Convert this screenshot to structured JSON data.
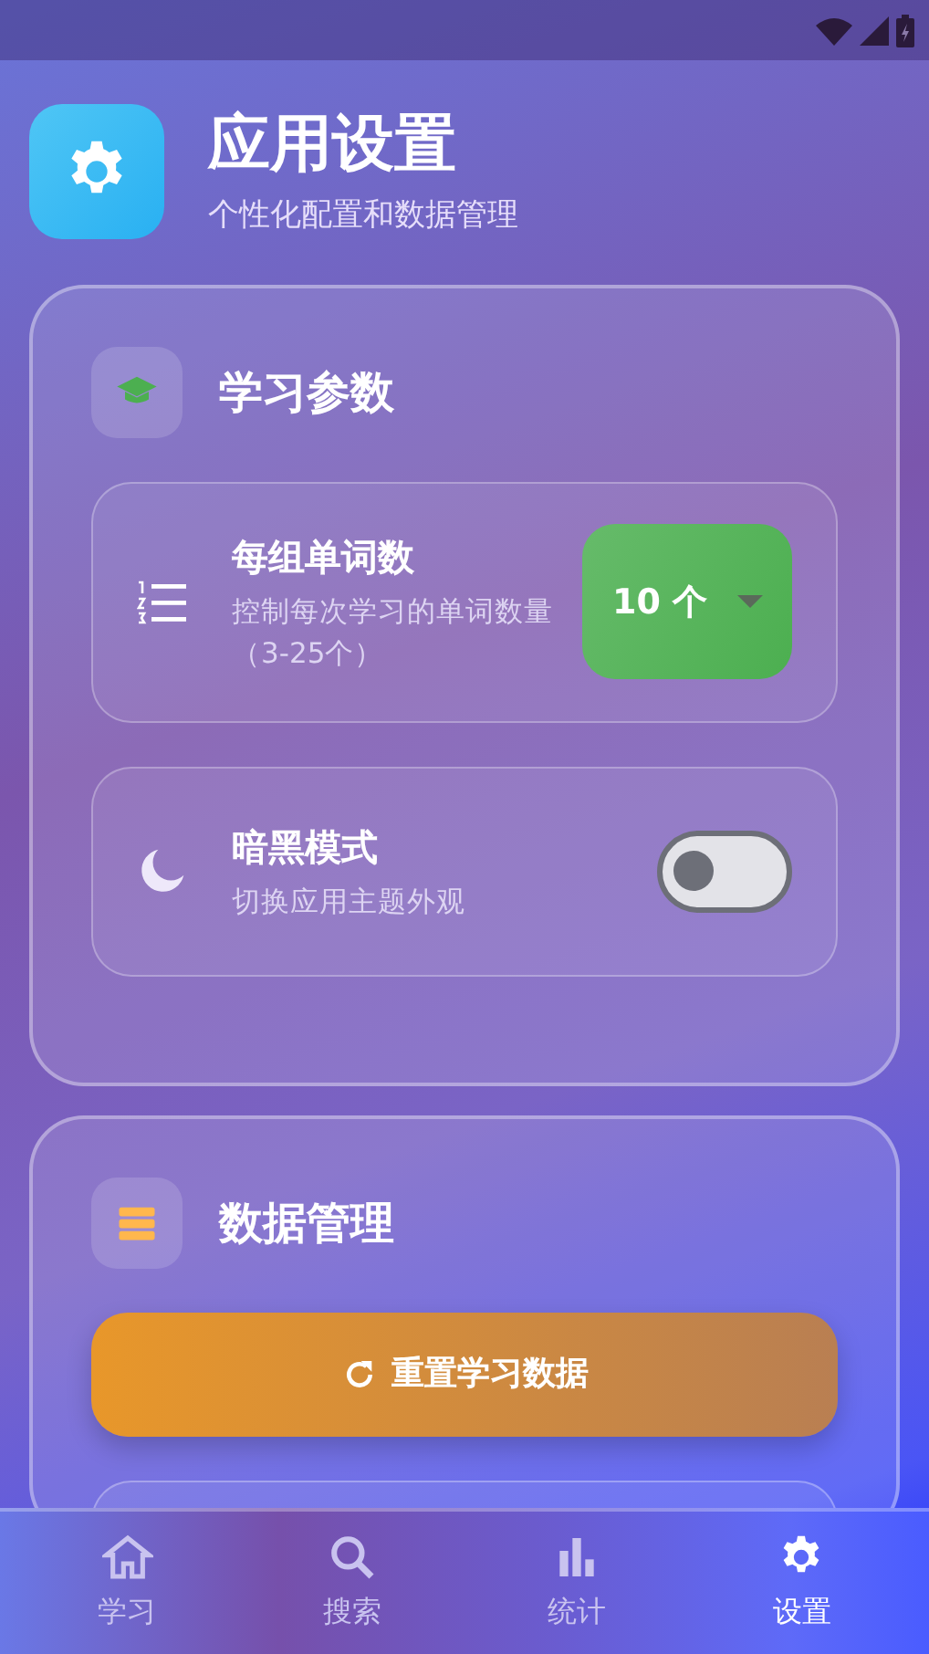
{
  "header": {
    "title": "应用设置",
    "subtitle": "个性化配置和数据管理"
  },
  "sections": [
    {
      "title": "学习参数",
      "settings": [
        {
          "kind": "select",
          "title": "每组单词数",
          "description": "控制每次学习的单词数量（3-25个）",
          "value": "10 个"
        },
        {
          "kind": "toggle",
          "title": "暗黑模式",
          "description": "切换应用主题外观",
          "on": false
        }
      ]
    },
    {
      "title": "数据管理",
      "actions": [
        {
          "label": "重置学习数据"
        }
      ]
    }
  ],
  "nav": [
    {
      "label": "学习",
      "selected": false
    },
    {
      "label": "搜索",
      "selected": false
    },
    {
      "label": "统计",
      "selected": false
    },
    {
      "label": "设置",
      "selected": true
    }
  ]
}
